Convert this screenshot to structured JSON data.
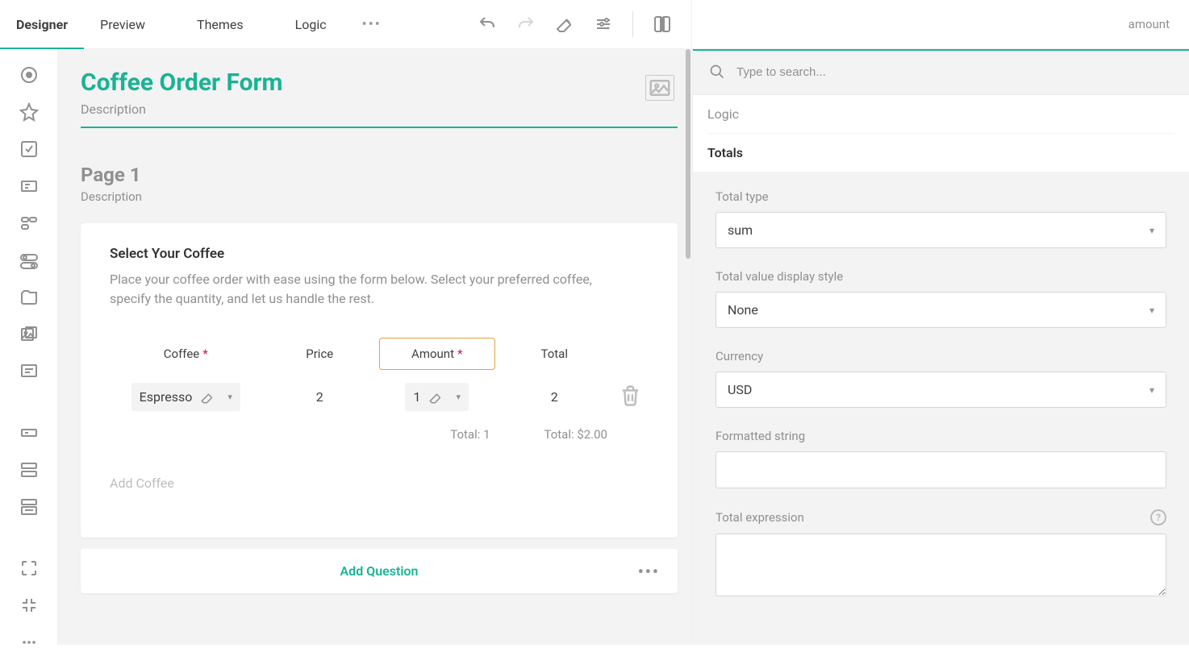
{
  "topbar": {
    "tabs": {
      "designer": "Designer",
      "preview": "Preview",
      "themes": "Themes",
      "logic": "Logic"
    },
    "breadcrumb": "amount"
  },
  "form": {
    "title": "Coffee Order Form",
    "description": "Description",
    "page": {
      "title": "Page 1",
      "description": "Description"
    },
    "question": {
      "title": "Select Your Coffee",
      "desc": "Place your coffee order with ease using the form below. Select your preferred coffee, specify the quantity, and let us handle the rest.",
      "columns": {
        "coffee": "Coffee",
        "price": "Price",
        "amount": "Amount",
        "total": "Total"
      },
      "row": {
        "coffee_value": "Espresso",
        "price_value": "2",
        "amount_value": "1",
        "total_value": "2"
      },
      "amount_total": "Total: 1",
      "grand_total": "Total: $2.00",
      "add_row": "Add Coffee",
      "add_question": "Add Question"
    }
  },
  "props": {
    "search_placeholder": "Type to search...",
    "section_logic": "Logic",
    "section_totals": "Totals",
    "total_type_label": "Total type",
    "total_type_value": "sum",
    "display_style_label": "Total value display style",
    "display_style_value": "None",
    "currency_label": "Currency",
    "currency_value": "USD",
    "formatted_label": "Formatted string",
    "expression_label": "Total expression"
  }
}
